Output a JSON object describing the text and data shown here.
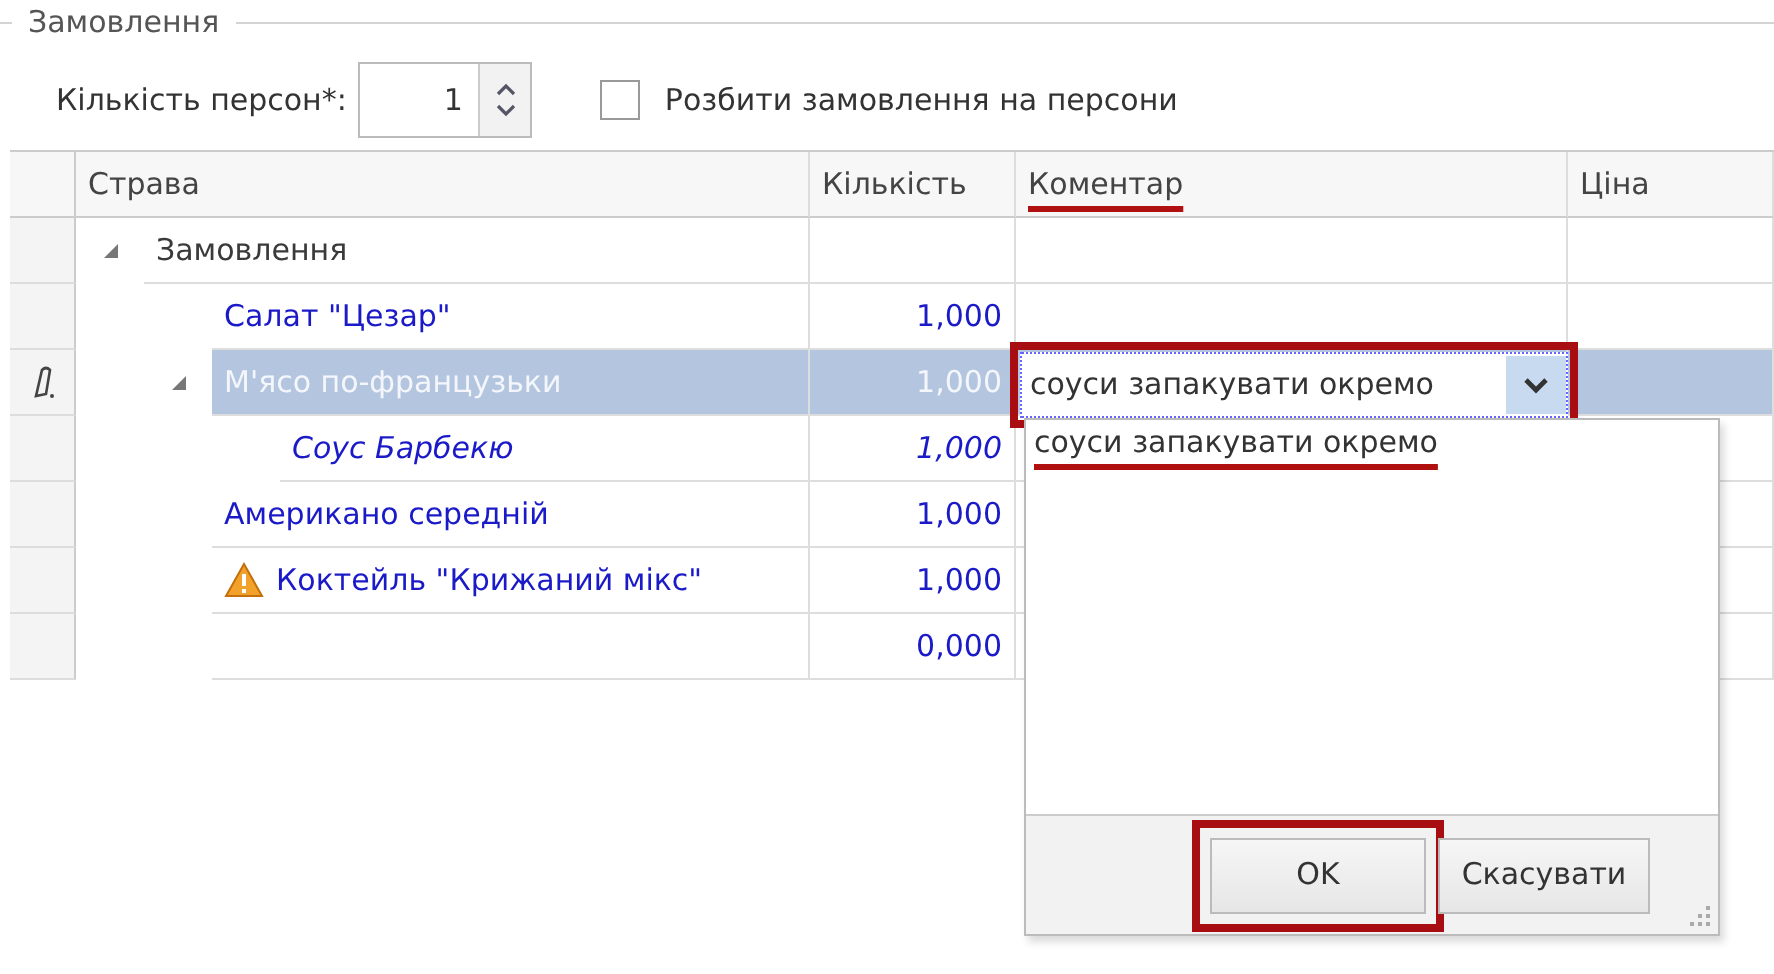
{
  "group_box": {
    "title": "Замовлення"
  },
  "persons": {
    "label": "Кількість персон*:",
    "value": "1"
  },
  "split_checkbox": {
    "label": "Розбити замовлення на персони",
    "checked": false
  },
  "table": {
    "columns": [
      {
        "label": "Страва",
        "underlined": false
      },
      {
        "label": "Кількість",
        "underlined": false
      },
      {
        "label": "Коментар",
        "underlined": true
      },
      {
        "label": "Ціна",
        "underlined": false
      }
    ],
    "rows": [
      {
        "kind": "group",
        "name": "Замовлення",
        "expanded": true,
        "selected": false,
        "children": [
          {
            "kind": "dish",
            "name": "Салат \"Цезар\"",
            "quantity": "1,000",
            "selected": false,
            "warning": false
          },
          {
            "kind": "dish",
            "name": "М'ясо по-французьки",
            "quantity": "1,000",
            "selected": true,
            "warning": false,
            "expanded": true,
            "children": [
              {
                "kind": "modifier",
                "name": "Соус Барбекю",
                "quantity": "1,000",
                "selected": false,
                "warning": false
              }
            ]
          },
          {
            "kind": "dish",
            "name": "Американо середній",
            "quantity": "1,000",
            "selected": false,
            "warning": false
          },
          {
            "kind": "dish",
            "name": "Коктейль \"Крижаний мікс\"",
            "quantity": "1,000",
            "selected": false,
            "warning": true
          },
          {
            "kind": "dish",
            "quantity": "0,000",
            "selected": false,
            "warning": false
          }
        ]
      }
    ]
  },
  "comment_editor": {
    "value": "соуси запакувати окремо",
    "framed": true
  },
  "comment_popup": {
    "text": "соуси запакувати окремо",
    "underlined": true,
    "buttons": [
      {
        "label": "OK",
        "framed": true
      },
      {
        "label": "Скасувати",
        "framed": false
      }
    ]
  }
}
